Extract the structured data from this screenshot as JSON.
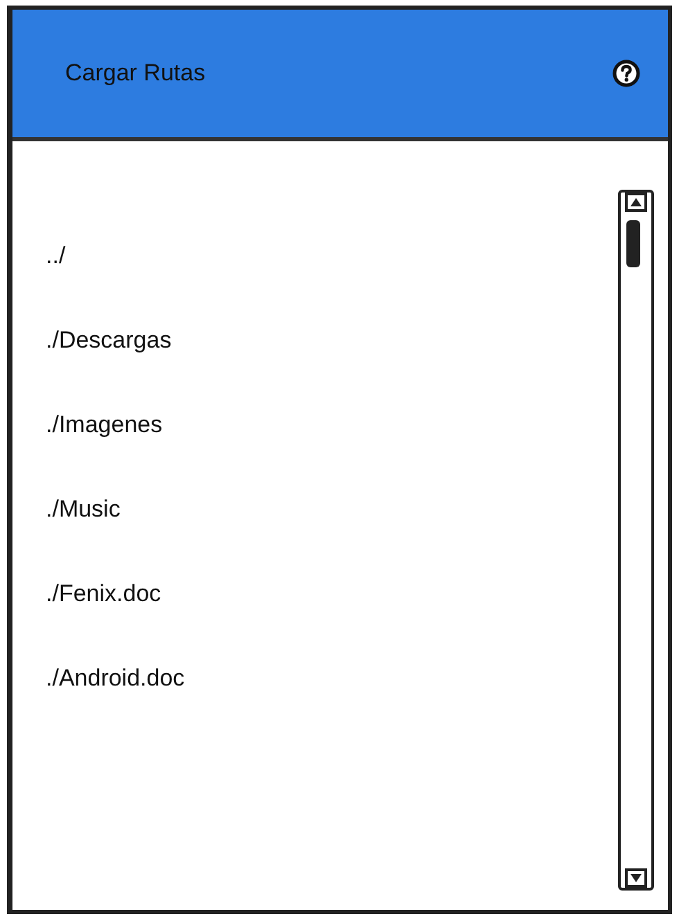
{
  "header": {
    "title": "Cargar Rutas"
  },
  "items": [
    {
      "label": "../"
    },
    {
      "label": "./Descargas"
    },
    {
      "label": "./Imagenes"
    },
    {
      "label": "./Music"
    },
    {
      "label": "./Fenix.doc"
    },
    {
      "label": "./Android.doc"
    }
  ]
}
